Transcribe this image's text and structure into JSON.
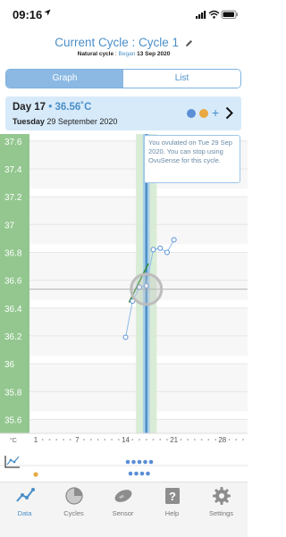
{
  "status_bar": {
    "time": "09:16"
  },
  "header": {
    "title_prefix": "Current Cycle",
    "title_sep": " : ",
    "title_value": "Cycle 1",
    "subtitle_type": "Natural cycle",
    "subtitle_sep": " : ",
    "subtitle_began": "Began",
    "subtitle_date": "13 Sep 2020"
  },
  "tabs": [
    {
      "label": "Graph",
      "active": true
    },
    {
      "label": "List",
      "active": false
    }
  ],
  "day": {
    "day_label": "Day 17",
    "sep": " • ",
    "temp": "36.56",
    "unit": "˚C",
    "weekday": "Tuesday",
    "date": "29 September 2020",
    "dots": [
      "#5b8fd6",
      "#e8a942"
    ],
    "add_label": "+"
  },
  "tooltip": {
    "text": "You ovulated on Tue 29 Sep 2020. You can stop using OvuSense for this cycle."
  },
  "chart_data": {
    "type": "line",
    "y_ticks": [
      "37.6",
      "37.4",
      "37.2",
      "37",
      "36.8",
      "36.6",
      "36.4",
      "36.2",
      "36",
      "35.8",
      "35.6"
    ],
    "ylim": [
      35.5,
      37.65
    ],
    "unit_label": "°C",
    "x_ticks": [
      "1",
      "7",
      "14",
      "21",
      "28"
    ],
    "xlim": [
      1,
      31
    ],
    "series": [
      {
        "x": [
          14,
          15,
          16,
          17,
          18,
          19,
          20,
          21
        ],
        "y": [
          36.19,
          36.45,
          36.55,
          36.56,
          36.82,
          36.83,
          36.8,
          36.89
        ]
      }
    ],
    "trend": {
      "x": [
        14.5,
        17.3
      ],
      "y": [
        36.44,
        36.72
      ]
    },
    "ovulation_day": 17,
    "fertile_window": [
      16,
      18
    ],
    "colors": {
      "y_axis_band": "#93c78f",
      "point": "#5b8fd6",
      "trend": "#3d8f3d",
      "ovulation": "#4a90c8"
    }
  },
  "mini_timeline": {
    "dots_blue": 5,
    "dots_blue_row2": 4
  },
  "nav": [
    {
      "label": "Data",
      "icon": "data-chart-icon",
      "active": true
    },
    {
      "label": "Cycles",
      "icon": "cycles-icon",
      "active": false
    },
    {
      "label": "Sensor",
      "icon": "sensor-icon",
      "active": false
    },
    {
      "label": "Help",
      "icon": "help-icon",
      "active": false
    },
    {
      "label": "Settings",
      "icon": "gear-icon",
      "active": false
    }
  ]
}
